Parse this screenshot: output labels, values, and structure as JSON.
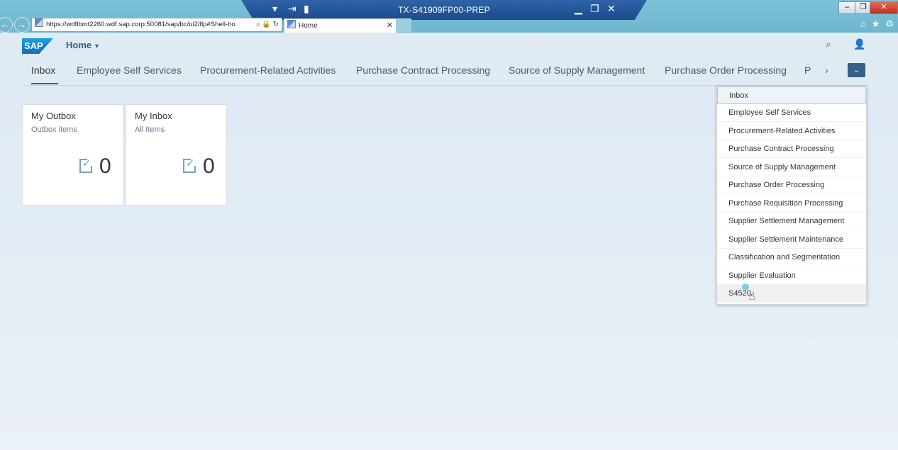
{
  "browser": {
    "remote_title": "TX-S41909FP00-PREP",
    "url": "https://wdflbmt2260.wdf.sap.corp:50081/sap/bc/ui2/flp#Shell-ho",
    "tab_title": "Home"
  },
  "shell": {
    "logo": "SAP",
    "home_label": "Home"
  },
  "tabs": [
    "Inbox",
    "Employee Self Services",
    "Procurement-Related Activities",
    "Purchase Contract Processing",
    "Source of Supply Management",
    "Purchase Order Processing",
    "P"
  ],
  "tiles": [
    {
      "title": "My Outbox",
      "subtitle": "Outbox items",
      "count": "0"
    },
    {
      "title": "My Inbox",
      "subtitle": "All Items",
      "count": "0"
    }
  ],
  "dropdown_items": [
    "Inbox",
    "Employee Self Services",
    "Procurement-Related Activities",
    "Purchase Contract Processing",
    "Source of Supply Management",
    "Purchase Order Processing",
    "Purchase Requisition Processing",
    "Supplier Settlement Management",
    "Supplier Settlement Maintenance",
    "Classification and Segmentation",
    "Supplier Evaluation",
    "S4520"
  ],
  "icons": {
    "back": "back-arrow-icon",
    "forward": "forward-arrow-icon",
    "search": "search-icon",
    "user": "user-icon",
    "overflow": "chevron-down-icon"
  },
  "colors": {
    "accent": "#346187",
    "browser_bar": "#7cc2d8",
    "remote_bar": "#1c4a8a"
  }
}
